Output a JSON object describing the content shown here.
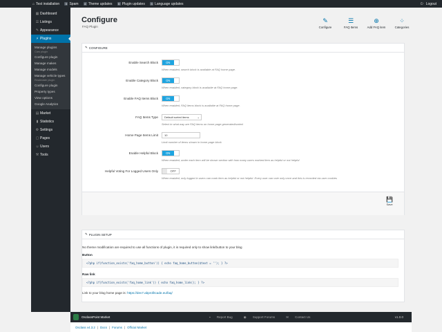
{
  "topbar": {
    "items": [
      {
        "icon": "home-icon",
        "glyph": "⌂",
        "label": "Test installation"
      },
      {
        "badge": "0",
        "label": "Spam"
      },
      {
        "badge": "4",
        "label": "Theme updates"
      },
      {
        "badge": "5",
        "label": "Plugin updates"
      },
      {
        "badge": "3",
        "label": "Language updates"
      }
    ],
    "logout": "Logout"
  },
  "sidebar": {
    "items": [
      {
        "label": "Dashboard",
        "icon": "dashboard-icon",
        "glyph": "▦"
      },
      {
        "label": "Listings",
        "icon": "listings-icon",
        "glyph": "☰"
      },
      {
        "label": "Appearance",
        "icon": "appearance-icon",
        "glyph": "✎"
      },
      {
        "label": "Plugins",
        "icon": "plugins-icon",
        "glyph": "⚡"
      }
    ],
    "submenu": {
      "manage_plugins": "Manage plugins",
      "cars_caption": "Cars plugin",
      "configure_plugin": "Configure plugin",
      "manage_makes": "Manage makes",
      "manage_models": "Manage models",
      "manage_vehicle_types": "Manage vehicle types",
      "realestate_caption": "Realestate plugin",
      "configure_plugin_2": "Configure plugin",
      "property_types": "Property types",
      "view_options": "View options",
      "google_analytics": "Google Analytics"
    },
    "items_bottom": [
      {
        "label": "Market",
        "icon": "market-icon",
        "glyph": "▤"
      },
      {
        "label": "Statistics",
        "icon": "statistics-icon",
        "glyph": "▮"
      },
      {
        "label": "Settings",
        "icon": "settings-icon",
        "glyph": "⚙"
      },
      {
        "label": "Pages",
        "icon": "pages-icon",
        "glyph": "▢"
      },
      {
        "label": "Users",
        "icon": "users-icon",
        "glyph": "☺"
      },
      {
        "label": "Tools",
        "icon": "tools-icon",
        "glyph": "⚒"
      }
    ]
  },
  "header": {
    "title": "Configure",
    "subtitle": "FAQ Plugin",
    "actions": [
      {
        "label": "Configure",
        "icon": "wrench-icon",
        "glyph": "✎"
      },
      {
        "label": "FAQ Items",
        "icon": "list-icon",
        "glyph": "☰"
      },
      {
        "label": "Add FAQ item",
        "icon": "add-icon",
        "glyph": "⊕"
      },
      {
        "label": "Categories",
        "icon": "categories-icon",
        "glyph": "⁘"
      }
    ]
  },
  "configure": {
    "heading": "CONFIGURE",
    "rows": [
      {
        "label": "Enable Search Block",
        "type": "toggle",
        "value": "ON",
        "help": "When enabled, search block is available at FAQ home page."
      },
      {
        "label": "Enable Category Block",
        "type": "toggle",
        "value": "ON",
        "help": "When enabled, category block is available at FAQ home page."
      },
      {
        "label": "Enable FAQ Items Block",
        "type": "toggle",
        "value": "ON",
        "help": "When enabled, FAQ items block is available at FAQ home page."
      },
      {
        "label": "FAQ Items Type",
        "type": "select",
        "value": "Default sorted items",
        "help": "Select in what way are FAQ items on home page generated/sorted"
      },
      {
        "label": "Home Page Items Limit",
        "type": "input",
        "value": "10",
        "help": "Limit number of items shown in home page block"
      },
      {
        "label": "Enable Helpful Block",
        "type": "toggle",
        "value": "ON",
        "help": "When enabled, under each item will be shown section with how many users marked item as helpful or not helpful"
      },
      {
        "label": "Helpful Voting For Logged Users Only",
        "type": "toggle-off",
        "value": "OFF",
        "help": "When enabled, only logged in users can mark item as helpful or not helpful. Every user can vote only once and this is recorded via user cookies"
      }
    ],
    "save": "Save"
  },
  "setup": {
    "heading": "PLUGIN SETUP",
    "intro": "No theme modification are required to use all functions of plugin, it is required only to show link/button to your blog",
    "button_title": "Button",
    "button_code": "<?php if(function_exists('faq_home_button')) { echo faq_home_button($text = ''); } ?>",
    "raw_title": "Raw link",
    "raw_code": "<?php if(function_exists('faq_home_link')) { echo faq_home_link(); } ?>",
    "home_text": "Link to your blog home page is:",
    "home_link": "https://dev7.abprofitcade.eu/faq/"
  },
  "footer": {
    "brand": "OsclassPoint Market",
    "links": [
      "Report Bug",
      "Support Forums",
      "Contact Us"
    ],
    "version": "v1.0.0"
  },
  "subfooter": {
    "items": [
      "Osclass v4.3.2",
      "|",
      "Docs",
      "|",
      "Forums",
      "|",
      "Official Market"
    ]
  }
}
